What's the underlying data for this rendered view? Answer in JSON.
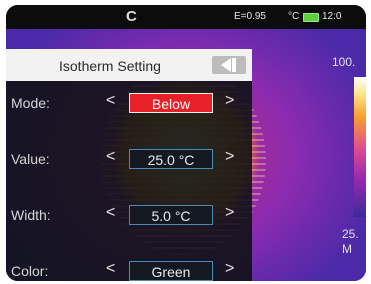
{
  "status_bar": {
    "refresh_icon": "refresh-icon",
    "emissivity": "E=0.95",
    "unit": "°C",
    "battery_icon": "battery-icon",
    "time": "12:0"
  },
  "thermal_view": {
    "max_temp": "100.",
    "min_temp_line1": "25.",
    "min_temp_line2": "M"
  },
  "panel": {
    "title": "Isotherm Setting",
    "back_icon": "back-icon",
    "rows": [
      {
        "label": "Mode:",
        "value": "Below"
      },
      {
        "label": "Value:",
        "value": "25.0 °C"
      },
      {
        "label": "Width:",
        "value": "5.0 °C"
      },
      {
        "label": "Color:",
        "value": "Green"
      }
    ],
    "left_arrow": "<",
    "right_arrow": ">"
  },
  "colors": {
    "selected": "#e82028",
    "box_border": "#4a89b8",
    "header_bg": "#f2f2f2"
  }
}
